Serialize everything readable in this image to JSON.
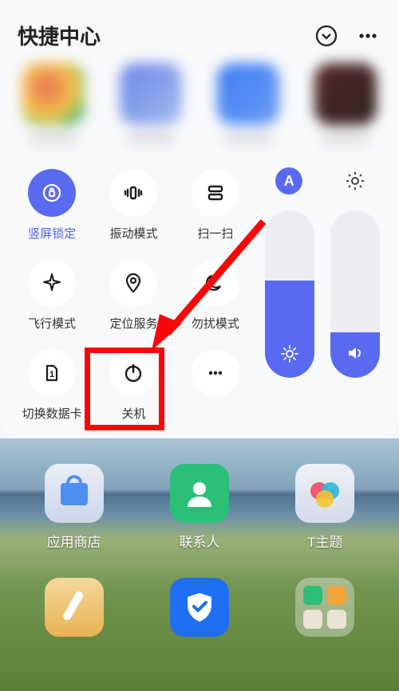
{
  "header": {
    "title": "快捷中心"
  },
  "quick_toggles": [
    {
      "label": "竖屏锁定",
      "icon": "lock-rotate",
      "active": true
    },
    {
      "label": "振动模式",
      "icon": "vibrate",
      "active": false
    },
    {
      "label": "扫一扫",
      "icon": "scan",
      "active": false
    },
    {
      "label": "飞行模式",
      "icon": "airplane",
      "active": false
    },
    {
      "label": "定位服务",
      "icon": "location",
      "active": false
    },
    {
      "label": "勿扰模式",
      "icon": "dnd",
      "active": false
    },
    {
      "label": "切换数据卡",
      "icon": "sim",
      "active": false
    },
    {
      "label": "关机",
      "icon": "power",
      "active": false
    },
    {
      "label": "",
      "icon": "more",
      "active": false
    }
  ],
  "sliders": {
    "auto_label": "A",
    "brightness_percent": 58,
    "volume_percent": 27
  },
  "home_apps": [
    {
      "label": "应用商店"
    },
    {
      "label": "联系人"
    },
    {
      "label": "T主题"
    }
  ],
  "annotation": {
    "highlight_target": "power-toggle",
    "highlight_color": "#fb0606"
  }
}
